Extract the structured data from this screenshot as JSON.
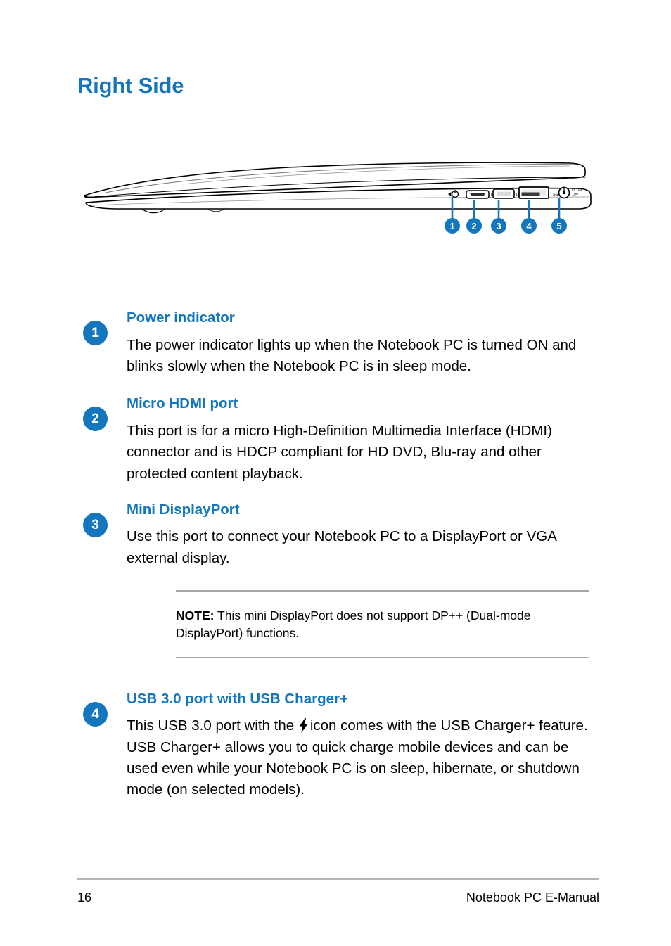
{
  "document": {
    "title": "Right Side"
  },
  "figure": {
    "alt_name": "notebook-right-side-illustration",
    "callouts": [
      "1",
      "2",
      "3",
      "4",
      "5"
    ],
    "port_labels": {
      "hdmi": "HDMI",
      "displayport": "DP",
      "usb": "SS",
      "dcin": "DC IN"
    }
  },
  "sections": [
    {
      "number": "1",
      "title": "Power indicator",
      "body": "The power indicator lights up when the Notebook PC is turned ON and blinks slowly when the Notebook PC is in sleep mode."
    },
    {
      "number": "2",
      "title": "Micro HDMI port",
      "body": "This port is for a micro High-Definition Multimedia Interface (HDMI) connector and is HDCP compliant for HD DVD, Blu-ray and other protected content playback."
    },
    {
      "number": "3",
      "title": "Mini DisplayPort",
      "body": "Use this port to connect your Notebook PC to a DisplayPort or VGA external display."
    }
  ],
  "note": {
    "label": "NOTE:",
    "text": " This mini DisplayPort does not support DP++ (Dual-mode DisplayPort) functions."
  },
  "usb_section": {
    "number": "4",
    "title": "USB 3.0 port with USB Charger+",
    "body_before_icon": "This USB 3.0 port with the ",
    "body_after_icon": "icon comes with the USB Charger+ feature. USB Charger+ allows you to quick charge mobile devices and can be used even while your Notebook PC is on sleep, hibernate, or shutdown mode (on selected models)."
  },
  "footer": {
    "page_number": "16",
    "manual_title": "Notebook PC E-Manual"
  },
  "colors": {
    "accent_blue": "#1477bd",
    "rule_gray": "#a6a6a6",
    "footer_rule": "#b5b5b5"
  }
}
